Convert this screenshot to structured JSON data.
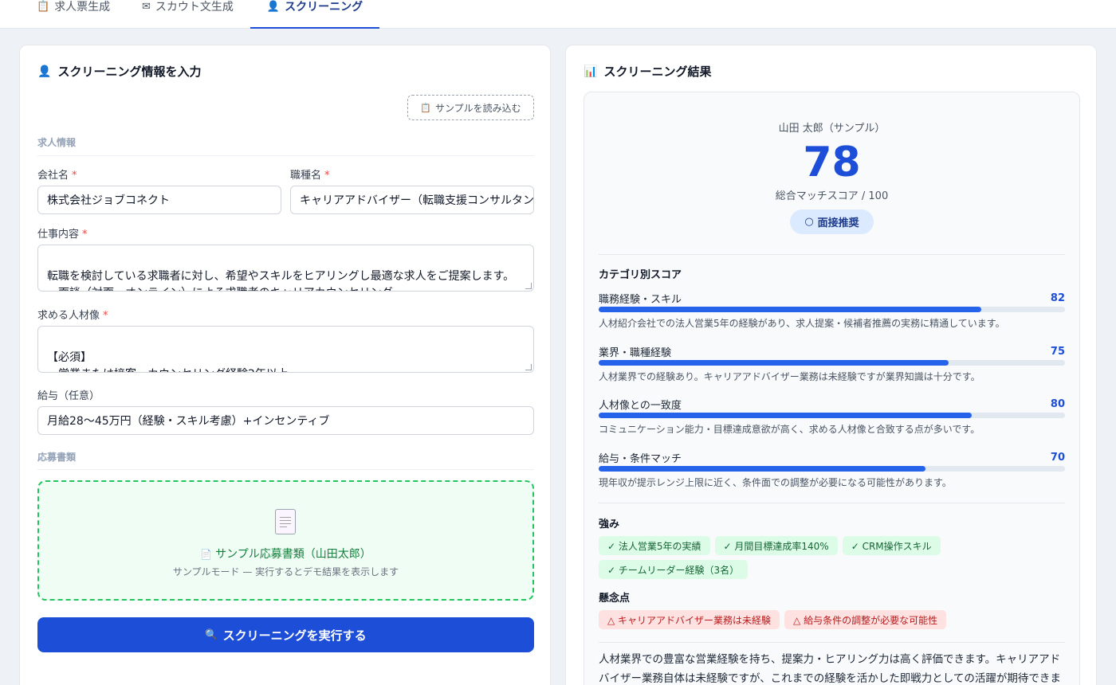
{
  "tabs": [
    {
      "icon": "📋",
      "label": "求人票生成"
    },
    {
      "icon": "✉",
      "label": "スカウト文生成"
    },
    {
      "icon": "👤",
      "label": "スクリーニング"
    }
  ],
  "left": {
    "title_icon": "👤",
    "title": "スクリーニング情報を入力",
    "sample_icon": "📋",
    "sample_button": "サンプルを読み込む",
    "section_job": "求人情報",
    "company_label": "会社名",
    "company_value": "株式会社ジョブコネクト",
    "position_label": "職種名",
    "position_value": "キャリアアドバイザー（転職支援コンサルタント）",
    "job_desc_label": "仕事内容",
    "job_desc_value": "転職を検討している求職者に対し、希望やスキルをヒアリングし最適な求人をご提案します。\n・面談（対面・オンライン）による求職者のキャリアカウンセリング\n・求人票作成、企業への候補者推薦",
    "ideal_label": "求める人材像",
    "ideal_value": "【必須】\n・営業または接客・カウンセリング経験2年以上\n・人の話を丁寧に聞き、信頼関係を築ける方",
    "salary_label": "給与（任意）",
    "salary_value": "月給28〜45万円（経験・スキル考慮）+インセンティブ",
    "required_mark": "*",
    "section_docs": "応募書類",
    "doc_icon": "📄",
    "doc_title": "サンプル応募書類（山田太郎）",
    "doc_sub": "サンプルモード — 実行するとデモ結果を表示します",
    "run_icon": "🔍",
    "run_button": "スクリーニングを実行する"
  },
  "right": {
    "title_icon": "📊",
    "title": "スクリーニング結果",
    "candidate": "山田 太郎（サンプル）",
    "score": "78",
    "score_label": "総合マッチスコア / 100",
    "verdict_icon": "○",
    "verdict": "面接推奨",
    "category_heading": "カテゴリ別スコア",
    "categories": [
      {
        "name": "職務経験・スキル",
        "score": 82,
        "score_text": "82",
        "note": "人材紹介会社での法人営業5年の経験があり、求人提案・候補者推薦の実務に精通しています。"
      },
      {
        "name": "業界・職種経験",
        "score": 75,
        "score_text": "75",
        "note": "人材業界での経験あり。キャリアアドバイザー業務は未経験ですが業界知識は十分です。"
      },
      {
        "name": "人材像との一致度",
        "score": 80,
        "score_text": "80",
        "note": "コミュニケーション能力・目標達成意欲が高く、求める人材像と合致する点が多いです。"
      },
      {
        "name": "給与・条件マッチ",
        "score": 70,
        "score_text": "70",
        "note": "現年収が提示レンジ上限に近く、条件面での調整が必要になる可能性があります。"
      }
    ],
    "strengths_heading": "強み",
    "strengths": [
      "✓ 法人営業5年の実績",
      "✓ 月間目標達成率140%",
      "✓ CRM操作スキル",
      "✓ チームリーダー経験（3名）"
    ],
    "concerns_heading": "懸念点",
    "concerns": [
      "△ キャリアアドバイザー業務は未経験",
      "△ 給与条件の調整が必要な可能性"
    ],
    "summary": "人材業界での豊富な営業経験を持ち、提案力・ヒアリング力は高く評価できます。キャリアアドバイザー業務自体は未経験ですが、これまでの経験を活かした即戦力としての活躍が期待できます。"
  },
  "colors": {
    "accent": "#1d4ed8",
    "bar": "#2563eb",
    "dropzone_border": "#22c55e",
    "good_tag_bg": "#dcfce7",
    "bad_tag_bg": "#fee2e2"
  }
}
